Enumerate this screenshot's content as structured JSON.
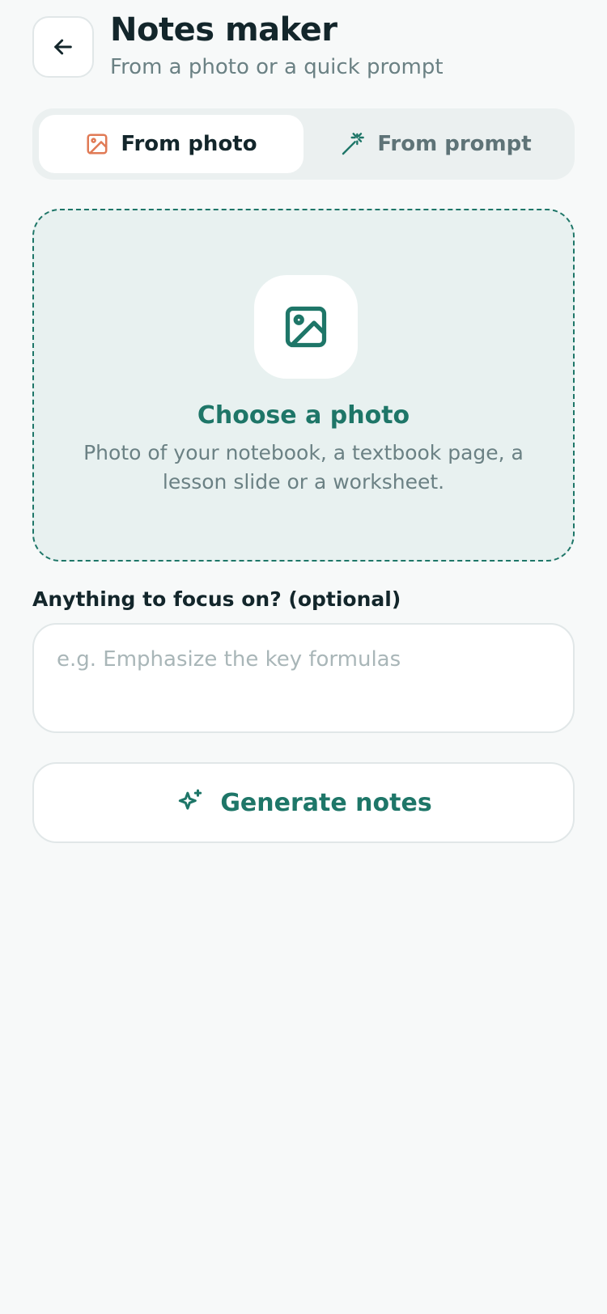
{
  "header": {
    "back_icon": "arrow-left-icon",
    "title": "Notes maker",
    "subtitle": "From a photo or a quick prompt"
  },
  "source_tabs": [
    {
      "label": "From photo",
      "icon": "image-icon",
      "selected": true
    },
    {
      "label": "From prompt",
      "icon": "magic-wand-icon",
      "selected": false
    }
  ],
  "dropzone": {
    "icon": "image-icon",
    "title": "Choose a photo",
    "description": "Photo of your notebook, a textbook page, a lesson slide or a worksheet."
  },
  "focus": {
    "label": "Anything to focus on? (optional)",
    "value": "",
    "placeholder": "e.g. Emphasize the key formulas"
  },
  "generate_button": {
    "label": "Generate notes",
    "icon": "sparkle-icon"
  },
  "colors": {
    "accent": "#1E7668",
    "photo_icon_accent": "#E07A55",
    "background": "#F7F9F9",
    "dropzone_bg": "#E8F1F0"
  }
}
